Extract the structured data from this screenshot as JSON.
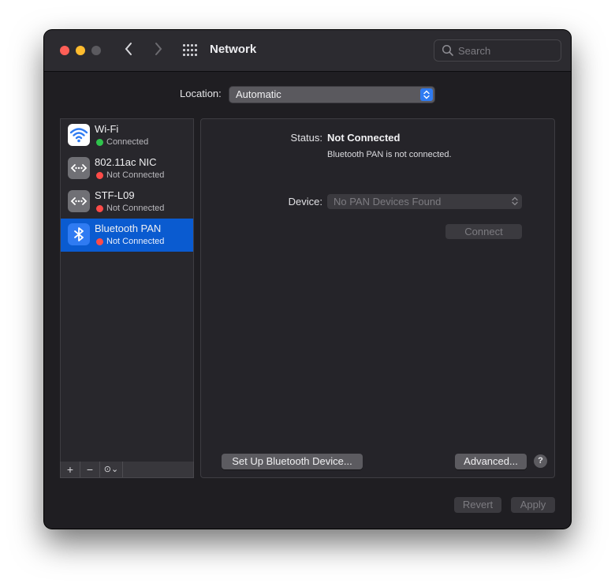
{
  "window": {
    "title": "Network"
  },
  "search": {
    "placeholder": "Search"
  },
  "location": {
    "label": "Location:",
    "value": "Automatic"
  },
  "services": [
    {
      "name": "Wi-Fi",
      "status": "Connected",
      "status_color": "#2fc34c",
      "icon": "wifi-icon",
      "selected": false
    },
    {
      "name": "802.11ac NIC",
      "status": "Not Connected",
      "status_color": "#ff4b48",
      "icon": "ethernet-icon",
      "selected": false
    },
    {
      "name": "STF-L09",
      "status": "Not Connected",
      "status_color": "#ff4b48",
      "icon": "ethernet-icon",
      "selected": false
    },
    {
      "name": "Bluetooth PAN",
      "status": "Not Connected",
      "status_color": "#ff4b48",
      "icon": "bluetooth-icon",
      "selected": true
    }
  ],
  "list_toolbar": {
    "add": "+",
    "remove": "−",
    "action": "⊙⌄"
  },
  "detail": {
    "status_label": "Status:",
    "status_value": "Not Connected",
    "status_description": "Bluetooth PAN is not connected.",
    "device_label": "Device:",
    "device_value": "No PAN Devices Found",
    "connect_label": "Connect",
    "setup_label": "Set Up Bluetooth Device...",
    "advanced_label": "Advanced...",
    "help_label": "?"
  },
  "footer": {
    "revert_label": "Revert",
    "apply_label": "Apply"
  },
  "colors": {
    "accent": "#2f7bf2",
    "selection": "#0a5bd0",
    "window_bg": "#1f1e22"
  }
}
